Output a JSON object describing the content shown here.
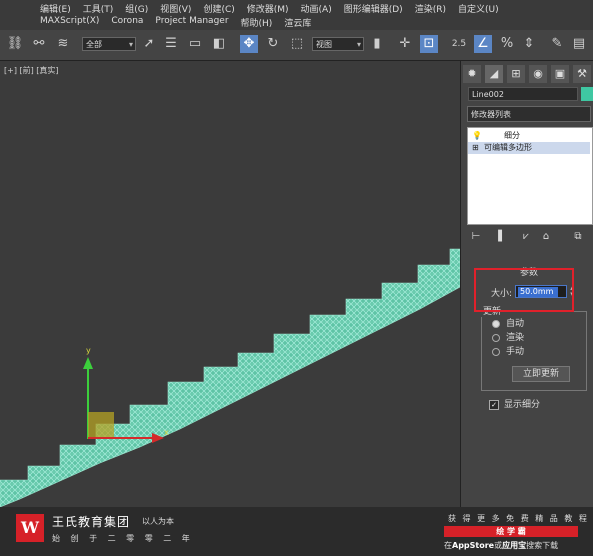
{
  "menu": {
    "row1": [
      "编辑(E)",
      "工具(T)",
      "组(G)",
      "视图(V)",
      "创建(C)",
      "修改器(M)",
      "动画(A)",
      "图形编辑器(D)",
      "渲染(R)",
      "自定义(U)"
    ],
    "row2": [
      "MAXScript(X)",
      "Corona",
      "Project Manager",
      "帮助(H)",
      "渲云库"
    ]
  },
  "toolbar": {
    "filter_value": "全部",
    "view_value": "视图",
    "spinner_snap_label": "2.5",
    "percent_snap_label": "%"
  },
  "viewport": {
    "label": "[+] [前] [真实]"
  },
  "panel": {
    "object_name": "Line002",
    "modifier_list": "修改器列表",
    "stack": [
      {
        "label": "细分",
        "selected": false
      },
      {
        "label": "可编辑多边形",
        "selected": true
      }
    ],
    "rollout_title": "参数",
    "size_label": "大小:",
    "size_value": "50.0mm",
    "update_title": "更新",
    "update_options": [
      {
        "label": "自动",
        "checked": true
      },
      {
        "label": "渲染",
        "checked": false
      },
      {
        "label": "手动",
        "checked": false
      }
    ],
    "update_button": "立即更新",
    "show_subdivision_label": "显示细分",
    "show_subdivision_checked": true
  },
  "watermark": {
    "logo_letter": "W",
    "brand": "王氏教育集团",
    "brand_sub": "以人为本",
    "brand_line2": "始 创 于 二 零 零 二 年",
    "promo_line1": "获 得 更 多 免 费 精 品 教 程",
    "promo_bar": "绘 学 霸",
    "promo_line3_prefix": "在",
    "promo_line3_store": "AppStore",
    "promo_line3_mid": "或",
    "promo_line3_app": "应用宝",
    "promo_line3_suffix": "搜索下载"
  },
  "colors": {
    "highlight": "#e0212b",
    "mesh": "#6fd1b3",
    "accent": "#5b86c5"
  }
}
